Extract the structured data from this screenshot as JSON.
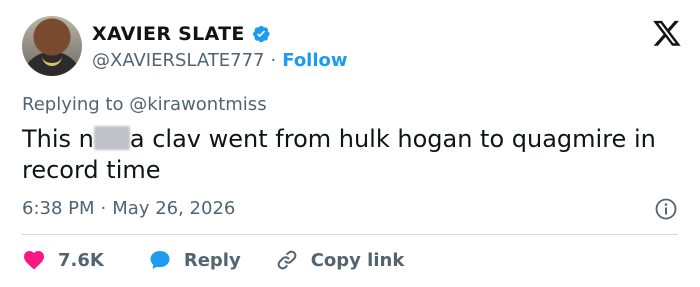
{
  "author": {
    "display_name": "XAVIER SLATE",
    "handle": "@XAVIERSLATE777",
    "separator": "·",
    "follow_label": "Follow"
  },
  "reply_context": {
    "prefix": "Replying to",
    "mention": "@kirawontmiss"
  },
  "tweet": {
    "text_before_censor": "This n",
    "text_after_censor": "a clav went from hulk hogan to quagmire in record time"
  },
  "meta": {
    "time": "6:38 PM",
    "separator": "·",
    "date": "May 26, 2026"
  },
  "actions": {
    "like_count": "7.6K",
    "reply_label": "Reply",
    "copy_label": "Copy link"
  },
  "icons": {
    "verified": "verified-badge-icon",
    "brand": "x-logo-icon",
    "info": "info-icon",
    "like": "heart-icon",
    "reply": "speech-bubble-icon",
    "copy": "link-icon"
  },
  "colors": {
    "accent": "#1d9bf0",
    "like": "#f91880",
    "text": "#0f1419",
    "secondary": "#536471",
    "divider": "#cfd9de"
  }
}
